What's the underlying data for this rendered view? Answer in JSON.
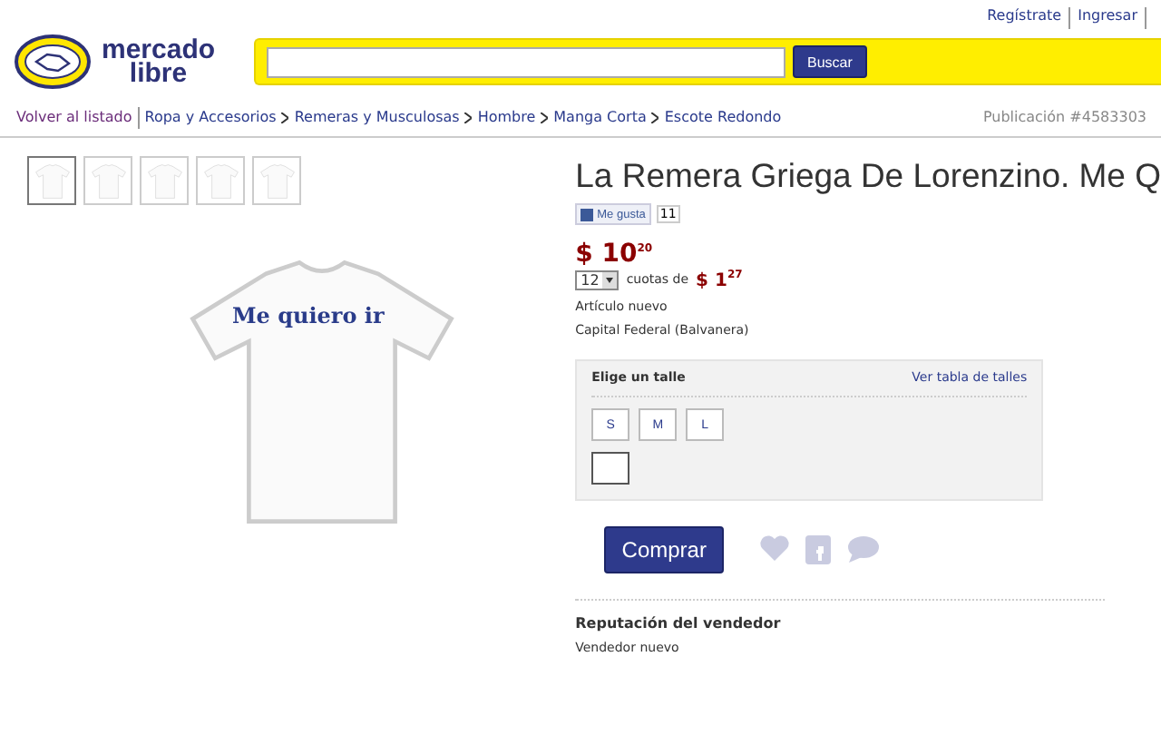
{
  "top_links": [
    "Regístrate",
    "Ingresar"
  ],
  "logo": {
    "line1": "mercado",
    "line2": "libre"
  },
  "search": {
    "button": "Buscar"
  },
  "breadcrumb": {
    "back": "Volver al listado",
    "items": [
      "Ropa y Accesorios",
      "Remeras y Musculosas",
      "Hombre",
      "Manga Corta",
      "Escote Redondo"
    ]
  },
  "publication": "Publicación #4583303",
  "thumbnails": [
    {
      "selected": true
    },
    {
      "selected": false
    },
    {
      "selected": false
    },
    {
      "selected": false
    },
    {
      "selected": false
    }
  ],
  "product_image": {
    "print_text": "Me quiero ir"
  },
  "title": "La Remera Griega De Lorenzino. Me Q",
  "like": {
    "label": "Me gusta",
    "count": "11"
  },
  "price": {
    "main": "$ 10",
    "cents": "20"
  },
  "installments": {
    "count": "12",
    "label": "cuotas de",
    "amount": "$ 1",
    "cents": "27"
  },
  "condition": "Artículo nuevo",
  "location": "Capital Federal (Balvanera)",
  "sizes": {
    "title": "Elige un talle",
    "link": "Ver tabla de talles",
    "options": [
      {
        "label": "S",
        "selected": false
      },
      {
        "label": "M",
        "selected": false
      },
      {
        "label": "L",
        "selected": false
      }
    ]
  },
  "buy_button": "Comprar",
  "reputation": {
    "title": "Reputación del vendedor",
    "value": "Vendedor nuevo"
  }
}
